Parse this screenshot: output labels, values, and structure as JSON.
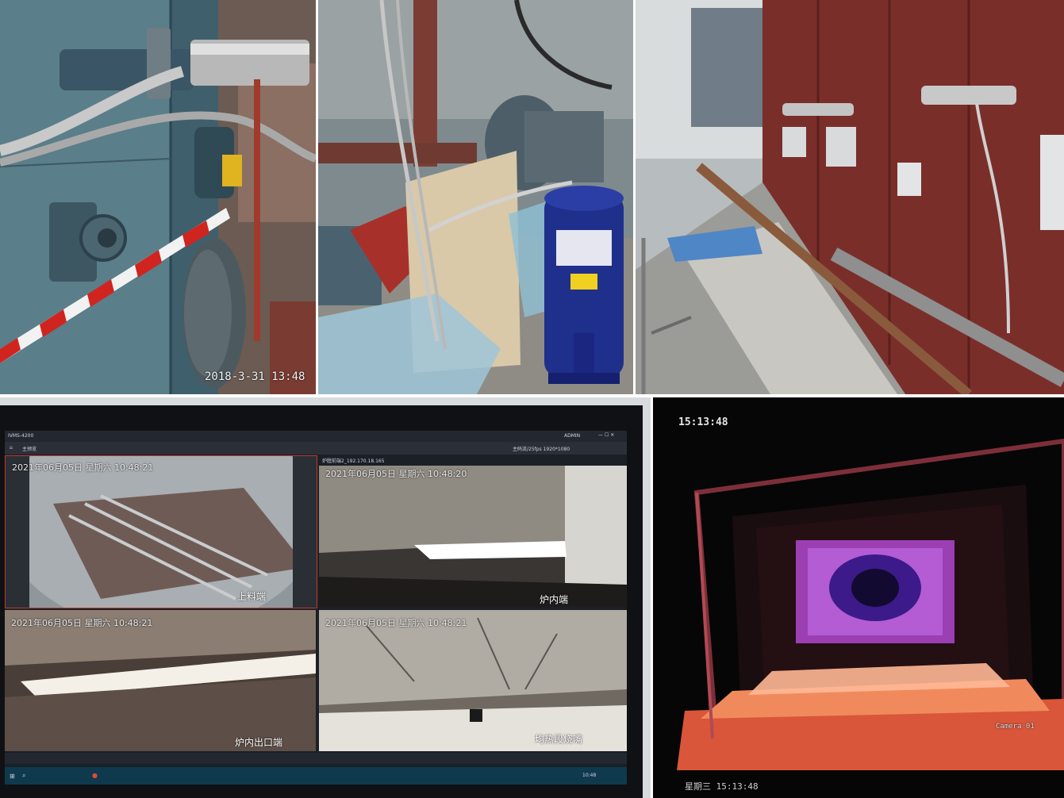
{
  "photo1": {
    "timestamp": "2018-3-31  13:48"
  },
  "monitor": {
    "app_title": "IVMS-4200",
    "menu_item": "主预览",
    "header_right": "ADMIN",
    "url_info": "炉膛前端2_192.170.18.165",
    "stream_info": "主码流/25fps 1920*1080",
    "cams": [
      {
        "osd": "2021年06月05日 星期六 10:48:21",
        "label": "上料端"
      },
      {
        "osd": "2021年06月05日 星期六 10:48:20",
        "label": "炉内端"
      },
      {
        "osd": "2021年06月05日 星期六 10:48:21",
        "label": "炉内出口端"
      },
      {
        "osd": "2021年06月05日 星期六 10:48:21",
        "label": "均热段烧嘴"
      }
    ],
    "tray_time": "10:48"
  },
  "dark": {
    "time_top": "15:13:48",
    "camera_label": "Camera 01",
    "bottom_osd": "星期三 15:13:48"
  }
}
